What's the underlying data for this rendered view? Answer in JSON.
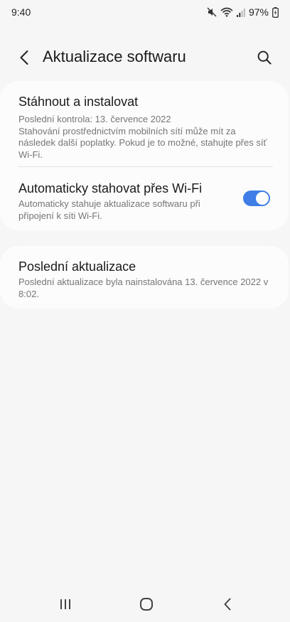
{
  "status_bar": {
    "time": "9:40",
    "battery": "97%",
    "icons": [
      "mute-icon",
      "wifi-icon",
      "signal-icon",
      "battery-icon"
    ]
  },
  "header": {
    "title": "Aktualizace softwaru",
    "back_icon": "back-arrow-icon",
    "search_icon": "search-icon"
  },
  "settings": {
    "download": {
      "title": "Stáhnout a instalovat",
      "last_check": "Poslední kontrola: 13. července 2022",
      "description": "Stahování prostřednictvím mobilních sítí může mít za následek další poplatky. Pokud je to možné, stahujte přes síť Wi-Fi."
    },
    "auto_download": {
      "title": "Automaticky stahovat přes Wi-Fi",
      "description": "Automaticky stahuje aktualizace softwaru při připojení k síti Wi-Fi.",
      "enabled": true
    },
    "last_update": {
      "title": "Poslední aktualizace",
      "description": "Poslední aktualizace byla nainstalována 13. července 2022 v 8:02."
    }
  },
  "colors": {
    "toggle_on": "#3e7ee6",
    "background": "#f6f6f6",
    "card": "#fcfcfc"
  },
  "nav_bar": {
    "icons": [
      "recents-icon",
      "home-icon",
      "back-icon"
    ]
  }
}
